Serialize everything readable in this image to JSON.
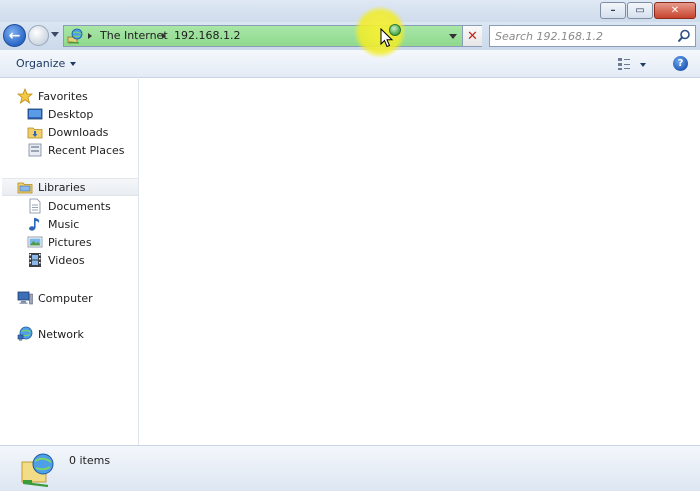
{
  "window": {
    "minimize_glyph": "–",
    "maximize_glyph": "▭",
    "close_glyph": "✕"
  },
  "navigation": {
    "back_glyph": "←",
    "address": {
      "breadcrumbs": [
        {
          "label": "The Internet"
        },
        {
          "label": "192.168.1.2"
        }
      ],
      "stop_glyph": "✕",
      "icon": "network-location-icon"
    },
    "search": {
      "placeholder": "Search 192.168.1.2",
      "icon": "search-icon"
    }
  },
  "toolbar": {
    "organize_label": "Organize",
    "views_icon": "change-view-icon",
    "help_glyph": "?"
  },
  "sidebar": {
    "favorites": {
      "label": "Favorites",
      "icon": "star-icon",
      "items": [
        {
          "label": "Desktop",
          "icon": "desktop-icon"
        },
        {
          "label": "Downloads",
          "icon": "downloads-folder-icon"
        },
        {
          "label": "Recent Places",
          "icon": "recent-places-icon"
        }
      ]
    },
    "libraries": {
      "label": "Libraries",
      "icon": "libraries-icon",
      "selected": true,
      "items": [
        {
          "label": "Documents",
          "icon": "documents-icon"
        },
        {
          "label": "Music",
          "icon": "music-note-icon"
        },
        {
          "label": "Pictures",
          "icon": "pictures-icon"
        },
        {
          "label": "Videos",
          "icon": "film-strip-icon"
        }
      ]
    },
    "computer": {
      "label": "Computer",
      "icon": "computer-icon"
    },
    "network": {
      "label": "Network",
      "icon": "network-icon"
    }
  },
  "status": {
    "item_count": "0 items",
    "icon": "network-location-large-icon"
  },
  "colors": {
    "address_progress": "#9be09a",
    "title_bar": "#d6e2f0",
    "close_button": "#c7442d",
    "cursor_highlight": "#f3ee2e"
  }
}
